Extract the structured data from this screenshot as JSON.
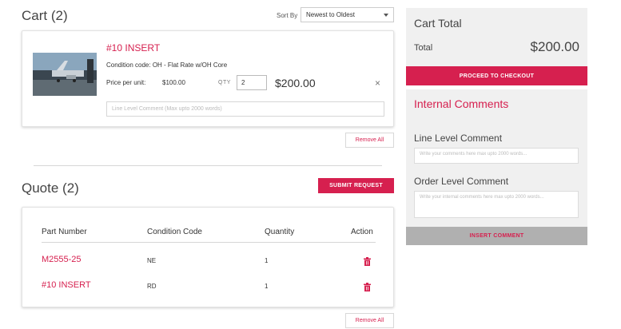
{
  "cart": {
    "title": "Cart (2)",
    "sort_label": "Sort By",
    "sort_value": "Newest to Oldest",
    "item": {
      "title": "#10 INSERT",
      "condition": "Condition code: OH - Flat Rate w/OH Core",
      "price_label": "Price per unit:",
      "price_value": "$100.00",
      "qty_label": "QTY",
      "qty_value": "2",
      "line_total": "$200.00",
      "remove_glyph": "×",
      "comment_placeholder": "Line Level Comment (Max upto 2000 words)"
    },
    "remove_all": "Remove All"
  },
  "quote": {
    "title": "Quote (2)",
    "submit_label": "SUBMIT REQUEST",
    "headers": [
      "Part Number",
      "Condition Code",
      "Quantity",
      "Action"
    ],
    "rows": [
      {
        "part": "M2555-25",
        "condition": "NE",
        "qty": "1"
      },
      {
        "part": "#10 INSERT",
        "condition": "RD",
        "qty": "1"
      }
    ],
    "remove_all": "Remove All"
  },
  "summary": {
    "title": "Cart Total",
    "total_label": "Total",
    "total_value": "$200.00",
    "checkout_label": "PROCEED TO CHECKOUT"
  },
  "comments": {
    "title": "Internal Comments",
    "line_label": "Line Level Comment",
    "line_placeholder": "Write your comments here max upto 2000 words...",
    "order_label": "Order Level Comment",
    "order_placeholder": "Write your internal comments here max upto 2000 words...",
    "insert_label": "INSERT COMMENT"
  },
  "colors": {
    "accent": "#d6204f",
    "panel_bg": "#f0f0f0",
    "insert_button_bg": "#b0b0b0"
  },
  "icons": {
    "sort": "chevron-down-icon",
    "remove": "close-icon",
    "action": "trash-icon",
    "item_image": "aircraft-photo"
  }
}
